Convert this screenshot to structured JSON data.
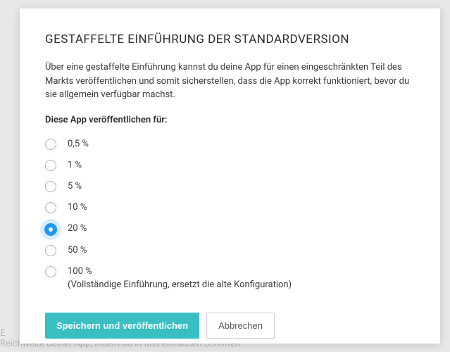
{
  "backdrop": {
    "bottom_line1": "E",
    "bottom_line2": "Reichweite deiner App, indem du in drei einfachen Schritten"
  },
  "modal": {
    "title": "GESTAFFELTE EINFÜHRUNG DER STANDARDVERSION",
    "description": "Über eine gestaffelte Einführung kannst du deine App für einen eingeschränkten Teil des Markts veröffentlichen und somit sicherstellen, dass die App korrekt funktioniert, bevor du sie allgemein verfügbar machst.",
    "group_label": "Diese App veröffentlichen für:",
    "options": [
      {
        "label": "0,5 %",
        "sub": "",
        "selected": false
      },
      {
        "label": "1 %",
        "sub": "",
        "selected": false
      },
      {
        "label": "5 %",
        "sub": "",
        "selected": false
      },
      {
        "label": "10 %",
        "sub": "",
        "selected": false
      },
      {
        "label": "20 %",
        "sub": "",
        "selected": true
      },
      {
        "label": "50 %",
        "sub": "",
        "selected": false
      },
      {
        "label": "100 %",
        "sub": "(Vollständige Einführung, ersetzt die alte Konfiguration)",
        "selected": false
      }
    ],
    "actions": {
      "primary": "Speichern und veröffentlichen",
      "secondary": "Abbrechen"
    }
  }
}
